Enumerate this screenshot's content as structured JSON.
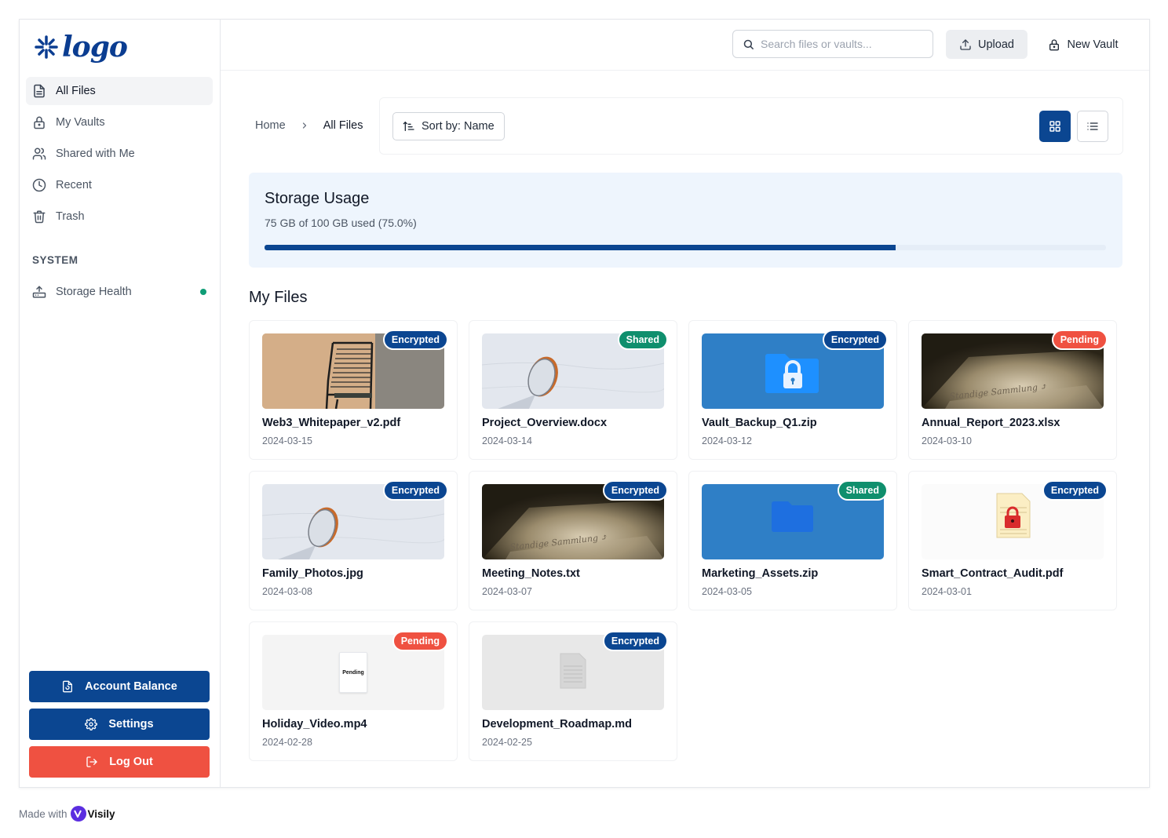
{
  "logo": {
    "text": "logo"
  },
  "sidebar": {
    "items": [
      {
        "label": "All Files",
        "icon": "file-icon",
        "active": true
      },
      {
        "label": "My Vaults",
        "icon": "lock-icon",
        "active": false
      },
      {
        "label": "Shared with Me",
        "icon": "users-icon",
        "active": false
      },
      {
        "label": "Recent",
        "icon": "clock-icon",
        "active": false
      },
      {
        "label": "Trash",
        "icon": "trash-icon",
        "active": false
      }
    ],
    "system_label": "SYSTEM",
    "storage_health": {
      "label": "Storage Health",
      "icon": "router-icon",
      "status_color": "#0f9d76"
    },
    "account_balance": "Account Balance",
    "settings": "Settings",
    "logout": "Log Out"
  },
  "topbar": {
    "search_placeholder": "Search files or vaults...",
    "upload_label": "Upload",
    "new_vault_label": "New Vault"
  },
  "breadcrumb": {
    "home": "Home",
    "current": "All Files"
  },
  "toolbar": {
    "sort_label": "Sort by: Name",
    "view_mode": "grid"
  },
  "storage": {
    "title": "Storage Usage",
    "summary": "75 GB of 100 GB used (75.0%)",
    "used_fraction": 0.75
  },
  "files_heading": "My Files",
  "colors": {
    "primary": "#0b4691",
    "danger": "#ef5141",
    "encrypted": "#0b4691",
    "shared": "#0f8f6d",
    "pending": "#ef5141"
  },
  "files": [
    {
      "name": "Web3_Whitepaper_v2.pdf",
      "date": "2024-03-15",
      "badge": "Encrypted",
      "thumb": "chair-photo"
    },
    {
      "name": "Project_Overview.docx",
      "date": "2024-03-14",
      "badge": "Shared",
      "thumb": "wall-mirror-photo"
    },
    {
      "name": "Vault_Backup_Q1.zip",
      "date": "2024-03-12",
      "badge": "Encrypted",
      "thumb": "locked-folder-icon"
    },
    {
      "name": "Annual_Report_2023.xlsx",
      "date": "2024-03-10",
      "badge": "Pending",
      "thumb": "dark-wall-photo"
    },
    {
      "name": "Family_Photos.jpg",
      "date": "2024-03-08",
      "badge": "Encrypted",
      "thumb": "wall-mirror-photo"
    },
    {
      "name": "Meeting_Notes.txt",
      "date": "2024-03-07",
      "badge": "Encrypted",
      "thumb": "dark-wall-photo"
    },
    {
      "name": "Marketing_Assets.zip",
      "date": "2024-03-05",
      "badge": "Shared",
      "thumb": "folder-icon"
    },
    {
      "name": "Smart_Contract_Audit.pdf",
      "date": "2024-03-01",
      "badge": "Encrypted",
      "thumb": "locked-document-icon"
    },
    {
      "name": "Holiday_Video.mp4",
      "date": "2024-02-28",
      "badge": "Pending",
      "thumb": "pending-document-icon",
      "thumb_text": "Pending"
    },
    {
      "name": "Development_Roadmap.md",
      "date": "2024-02-25",
      "badge": "Encrypted",
      "thumb": "document-icon"
    }
  ],
  "footer": {
    "made_with": "Made with",
    "brand": "Visily"
  }
}
